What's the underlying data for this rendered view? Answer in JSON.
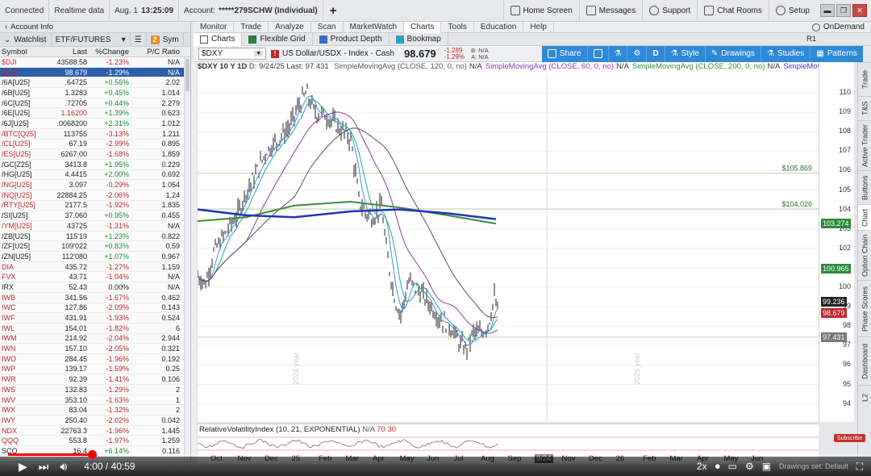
{
  "topbar": {
    "status": "Connected",
    "data_mode": "Realtime data",
    "date": "Aug. 1",
    "time": "13:25:09",
    "account_label": "Account:",
    "account_value": "*****279SCHW (Individual)",
    "add_label": "+",
    "home_screen": "Home Screen",
    "messages": "Messages",
    "support": "Support",
    "chat_rooms": "Chat Rooms",
    "setup": "Setup"
  },
  "left": {
    "account_info": "Account Info",
    "watchlist_label": "Watchlist",
    "watchlist_name": "ETF/FUTURES",
    "badge": "2",
    "sym_short": "Sym",
    "columns": [
      "Symbol",
      "Last",
      "%Change",
      "P/C Ratio"
    ],
    "rows": [
      {
        "sym": "$DJI",
        "last": "43588.58",
        "chg": "-1.23%",
        "pc": "N/A",
        "sign": "neg",
        "red": true
      },
      {
        "sym": "$DXY",
        "last": "98.679",
        "chg": "-1.29%",
        "pc": "N/A",
        "sign": "neg",
        "red": true,
        "selected": true
      },
      {
        "sym": "/6A[U25]",
        "last": ".64725",
        "chg": "+0.56%",
        "pc": "2.02",
        "sign": "pos"
      },
      {
        "sym": "/6B[U25]",
        "last": "1.3283",
        "chg": "+0.45%",
        "pc": "1.014",
        "sign": "pos"
      },
      {
        "sym": "/6C[U25]",
        "last": ".72705",
        "chg": "+0.44%",
        "pc": "2.279",
        "sign": "pos"
      },
      {
        "sym": "/6E[U25]",
        "last": "1.16200",
        "chg": "+1.39%",
        "pc": "0.623",
        "sign": "pos",
        "redlast": true
      },
      {
        "sym": "/6J[U25]",
        "last": ".0068200",
        "chg": "+2.31%",
        "pc": "1.012",
        "sign": "pos"
      },
      {
        "sym": "/BTC[Q25]",
        "last": "113755",
        "chg": "-3.13%",
        "pc": "1.211",
        "sign": "neg",
        "red": true
      },
      {
        "sym": "/CL[U25]",
        "last": "67.19",
        "chg": "-2.99%",
        "pc": "0.895",
        "sign": "neg",
        "red": true
      },
      {
        "sym": "/ES[U25]",
        "last": "6267.00",
        "chg": "-1.68%",
        "pc": "1.859",
        "sign": "neg",
        "red": true
      },
      {
        "sym": "/GC[Z25]",
        "last": "3413.8",
        "chg": "+1.95%",
        "pc": "0.229",
        "sign": "pos"
      },
      {
        "sym": "/HG[U25]",
        "last": "4.4415",
        "chg": "+2.00%",
        "pc": "0.692",
        "sign": "pos"
      },
      {
        "sym": "/NG[U25]",
        "last": "3.097",
        "chg": "-0.29%",
        "pc": "1.054",
        "sign": "neg",
        "red": true
      },
      {
        "sym": "/NQ[U25]",
        "last": "22884.25",
        "chg": "-2.06%",
        "pc": "1.24",
        "sign": "neg",
        "red": true
      },
      {
        "sym": "/RTY[U25]",
        "last": "2177.5",
        "chg": "-1.92%",
        "pc": "1.835",
        "sign": "neg",
        "red": true
      },
      {
        "sym": "/SI[U25]",
        "last": "37.060",
        "chg": "+0.95%",
        "pc": "0.455",
        "sign": "pos"
      },
      {
        "sym": "/YM[U25]",
        "last": "43725",
        "chg": "-1.31%",
        "pc": "N/A",
        "sign": "neg",
        "red": true
      },
      {
        "sym": "/ZB[U25]",
        "last": "115'19",
        "chg": "+1.23%",
        "pc": "0.822",
        "sign": "pos"
      },
      {
        "sym": "/ZF[U25]",
        "last": "109'022",
        "chg": "+0.83%",
        "pc": "0.59",
        "sign": "pos"
      },
      {
        "sym": "/ZN[U25]",
        "last": "112'080",
        "chg": "+1.07%",
        "pc": "0.967",
        "sign": "pos"
      },
      {
        "sym": "DIA",
        "last": "435.72",
        "chg": "-1.27%",
        "pc": "1.159",
        "sign": "neg",
        "red": true
      },
      {
        "sym": "FVX",
        "last": "43.71",
        "chg": "-1.04%",
        "pc": "N/A",
        "sign": "neg",
        "red": true
      },
      {
        "sym": "IRX",
        "last": "52.43",
        "chg": "0.00%",
        "pc": "N/A",
        "sign": "zero"
      },
      {
        "sym": "IWB",
        "last": "341.56",
        "chg": "-1.67%",
        "pc": "0.462",
        "sign": "neg",
        "red": true
      },
      {
        "sym": "IWC",
        "last": "127.86",
        "chg": "-2.09%",
        "pc": "0.143",
        "sign": "neg",
        "red": true
      },
      {
        "sym": "IWF",
        "last": "431.91",
        "chg": "-1.93%",
        "pc": "0.524",
        "sign": "neg",
        "red": true
      },
      {
        "sym": "IWL",
        "last": "154.01",
        "chg": "-1.82%",
        "pc": "6",
        "sign": "neg",
        "red": true
      },
      {
        "sym": "IWM",
        "last": "214.92",
        "chg": "-2.04%",
        "pc": "2.944",
        "sign": "neg",
        "red": true
      },
      {
        "sym": "IWN",
        "last": "157.10",
        "chg": "-2.05%",
        "pc": "0.321",
        "sign": "neg",
        "red": true
      },
      {
        "sym": "IWO",
        "last": "284.45",
        "chg": "-1.96%",
        "pc": "0.192",
        "sign": "neg",
        "red": true
      },
      {
        "sym": "IWP",
        "last": "139.17",
        "chg": "-1.59%",
        "pc": "0.25",
        "sign": "neg",
        "red": true
      },
      {
        "sym": "IWR",
        "last": "92.39",
        "chg": "-1.41%",
        "pc": "0.106",
        "sign": "neg",
        "red": true
      },
      {
        "sym": "IWS",
        "last": "132.83",
        "chg": "-1.29%",
        "pc": "2",
        "sign": "neg",
        "red": true
      },
      {
        "sym": "IWV",
        "last": "353.10",
        "chg": "-1.63%",
        "pc": "1",
        "sign": "neg",
        "red": true
      },
      {
        "sym": "IWX",
        "last": "83.04",
        "chg": "-1.32%",
        "pc": "2",
        "sign": "neg",
        "red": true
      },
      {
        "sym": "IWY",
        "last": "250.40",
        "chg": "-2.02%",
        "pc": "0.042",
        "sign": "neg",
        "red": true
      },
      {
        "sym": "NDX",
        "last": "22763.3",
        "chg": "-1.96%",
        "pc": "1.445",
        "sign": "neg",
        "red": true
      },
      {
        "sym": "QQQ",
        "last": "553.8",
        "chg": "-1.97%",
        "pc": "1.259",
        "sign": "neg",
        "red": true
      },
      {
        "sym": "SCO",
        "last": "16.4",
        "chg": "+6.14%",
        "pc": "0.116",
        "sign": "pos"
      }
    ]
  },
  "nav": {
    "tabs": [
      "Monitor",
      "Trade",
      "Analyze",
      "Scan",
      "MarketWatch",
      "Charts",
      "Tools",
      "Education",
      "Help"
    ],
    "active": "Charts",
    "ondemand": "OnDemand"
  },
  "subtabs": {
    "items": [
      "Charts",
      "Flexible Grid",
      "Product Depth",
      "Bookmap"
    ],
    "r1": "R1"
  },
  "chart_toolbar": {
    "symbol": "$DXY",
    "description": "US Dollar/USDX - Index - Cash",
    "last": "98.679",
    "net_change": "-1.289",
    "pct_change": "-1.29%",
    "bid": "B: N/A",
    "ask": "A: N/A",
    "share": "Share",
    "aggregation": "D",
    "style": "Style",
    "drawings": "Drawings",
    "studies": "Studies",
    "patterns": "Patterns"
  },
  "chart": {
    "header": "$DXY 10 Y 1D",
    "header_date": "D: 9/24/25 Last: 97.431",
    "studies": [
      {
        "text": "SimpleMovingAvg (CLOSE, 120, 0, no)",
        "value": "N/A",
        "color": "#555555"
      },
      {
        "text": "SimpleMovingAvg (CLOSE, 60, 0, no)",
        "value": "N/A",
        "color": "#8a3aa8"
      },
      {
        "text": "SimpleMovingAvg (CLOSE, 200, 0, no)",
        "value": "N/A",
        "color": "#3a8a3a"
      },
      {
        "text": "SimpleMovingAvg ...",
        "value": "",
        "color": "#3a3ac8"
      }
    ],
    "year_labels": [
      "2024 year",
      "2025 year"
    ],
    "hlines": [
      {
        "label": "$105.869",
        "price": 105.869
      },
      {
        "label": "$104.026",
        "price": 104.026
      }
    ],
    "price_ticks": [
      "110",
      "109",
      "108",
      "107",
      "106",
      "105",
      "104",
      "103",
      "102",
      "101",
      "100",
      "99",
      "98",
      "97",
      "96",
      "95",
      "94"
    ],
    "price_tags": [
      {
        "label": "103.274",
        "price": 103.274,
        "color": "#2e8a3a"
      },
      {
        "label": "100.965",
        "price": 100.965,
        "color": "#2e8a3a"
      },
      {
        "label": "99.236",
        "price": 99.236,
        "color": "#222222"
      },
      {
        "label": "98.679",
        "price": 98.679,
        "color": "#c0272d"
      },
      {
        "label": "97.431",
        "price": 97.431,
        "color": "#777777"
      }
    ],
    "time_labels": [
      "Oct",
      "Nov",
      "Dec",
      "25",
      "Feb",
      "Mar",
      "Apr",
      "May",
      "Jun",
      "Jul",
      "Aug",
      "Sep",
      "9/24",
      "Nov",
      "Dec",
      "26",
      "Feb",
      "Mar",
      "Apr",
      "May",
      "Jun"
    ]
  },
  "rv": {
    "label": "RelativeVolatilityIndex (10, 21, EXPONENTIAL)",
    "value": "N/A",
    "level_hi": "70",
    "level_lo": "30"
  },
  "right_tabs": [
    "Trade",
    "T&S",
    "Active Trader",
    "Buttons",
    "Chart",
    "Option Chain",
    "Phase Scores",
    "Dashboard",
    "L2"
  ],
  "video": {
    "time": "4:00 / 40:59",
    "progress": 0.098,
    "speed": "2x",
    "subscribe": "Subscribe",
    "overlay_text": "Drawings set: Default"
  }
}
